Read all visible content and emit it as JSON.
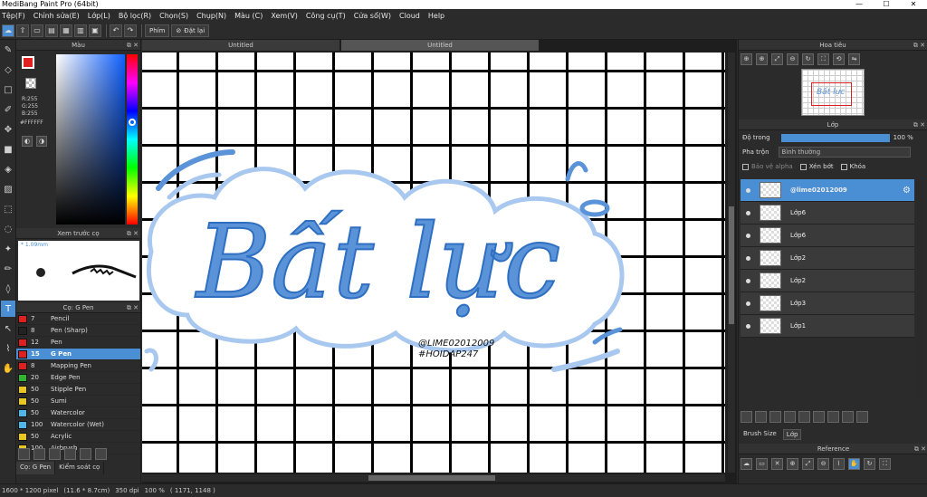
{
  "window": {
    "title": "MediBang Paint Pro (64bit)",
    "minimize": "—",
    "maximize": "☐",
    "close": "✕"
  },
  "menu": [
    "Tệp(F)",
    "Chỉnh sửa(E)",
    "Lớp(L)",
    "Bộ lọc(R)",
    "Chọn(S)",
    "Chụp(N)",
    "Màu (C)",
    "Xem(V)",
    "Công cụ(T)",
    "Cửa sổ(W)",
    "Cloud",
    "Help"
  ],
  "toolbar": {
    "pen_label": "Phím",
    "reset_label": "Đặt lại"
  },
  "color_panel": {
    "title": "Màu",
    "r": "R:255",
    "g": "G:255",
    "b": "B:255",
    "hex": "#FFFFFF"
  },
  "brush_preview": {
    "title": "Xem trước cọ",
    "size": "* 1.09mm"
  },
  "brush_panel": {
    "title": "Cọ: G Pen",
    "brushes": [
      {
        "size": "7",
        "name": "Pencil",
        "color": "#e02020",
        "selected": false
      },
      {
        "size": "8",
        "name": "Pen (Sharp)",
        "color": "#222222",
        "selected": false
      },
      {
        "size": "12",
        "name": "Pen",
        "color": "#e02020",
        "selected": false
      },
      {
        "size": "15",
        "name": "G Pen",
        "color": "#e02020",
        "selected": true
      },
      {
        "size": "8",
        "name": "Mapping Pen",
        "color": "#e02020",
        "selected": false
      },
      {
        "size": "20",
        "name": "Edge Pen",
        "color": "#2fb52f",
        "selected": false
      },
      {
        "size": "50",
        "name": "Stipple Pen",
        "color": "#e8c820",
        "selected": false
      },
      {
        "size": "50",
        "name": "Sumi",
        "color": "#e8c820",
        "selected": false
      },
      {
        "size": "50",
        "name": "Watercolor",
        "color": "#4fb7e8",
        "selected": false
      },
      {
        "size": "100",
        "name": "Watercolor (Wet)",
        "color": "#4fb7e8",
        "selected": false
      },
      {
        "size": "50",
        "name": "Acrylic",
        "color": "#e8c820",
        "selected": false
      },
      {
        "size": "100",
        "name": "Airbrush",
        "color": "#e8c820",
        "selected": false
      }
    ],
    "tab_brush": "Cọ: G Pen",
    "tab_control": "Kiểm soát cọ"
  },
  "doc_tabs": [
    "Untitled",
    "Untitled"
  ],
  "navigator": {
    "title": "Hoa tiêu",
    "thumb_text": "Bất lực"
  },
  "layer_panel": {
    "title": "Lớp",
    "opacity_label": "Độ trong",
    "opacity_value": "100 %",
    "opacity": 1.0,
    "blend_label": "Pha trộn",
    "blend_value": "Bình thường",
    "protect_alpha": "Bảo vệ alpha",
    "clipping": "Xén bớt",
    "lock": "Khóa",
    "layers": [
      {
        "name": "@lime02012009",
        "selected": true
      },
      {
        "name": "Lớp6",
        "selected": false
      },
      {
        "name": "Lớp6",
        "selected": false
      },
      {
        "name": "Lớp2",
        "selected": false
      },
      {
        "name": "Lớp2",
        "selected": false
      },
      {
        "name": "Lớp3",
        "selected": false
      },
      {
        "name": "Lớp1",
        "selected": false
      }
    ],
    "tab_brushsize": "Brush Size",
    "tab_layer": "Lớp"
  },
  "reference": {
    "title": "Reference"
  },
  "artwork": {
    "main_text": "Bất lực",
    "tag1": "@LIME02012009",
    "tag2": "#HOIDAP247"
  },
  "status": {
    "size": "1600 * 1200 pixel",
    "dims": "(11.6 * 8.7cm)",
    "dpi": "350 dpi",
    "zoom": "100 %",
    "coords": "( 1171, 1148 )"
  },
  "colors": {
    "accent": "#4a8fd4",
    "art_blue": "#5b93d9",
    "art_light": "#a9c8f0"
  }
}
